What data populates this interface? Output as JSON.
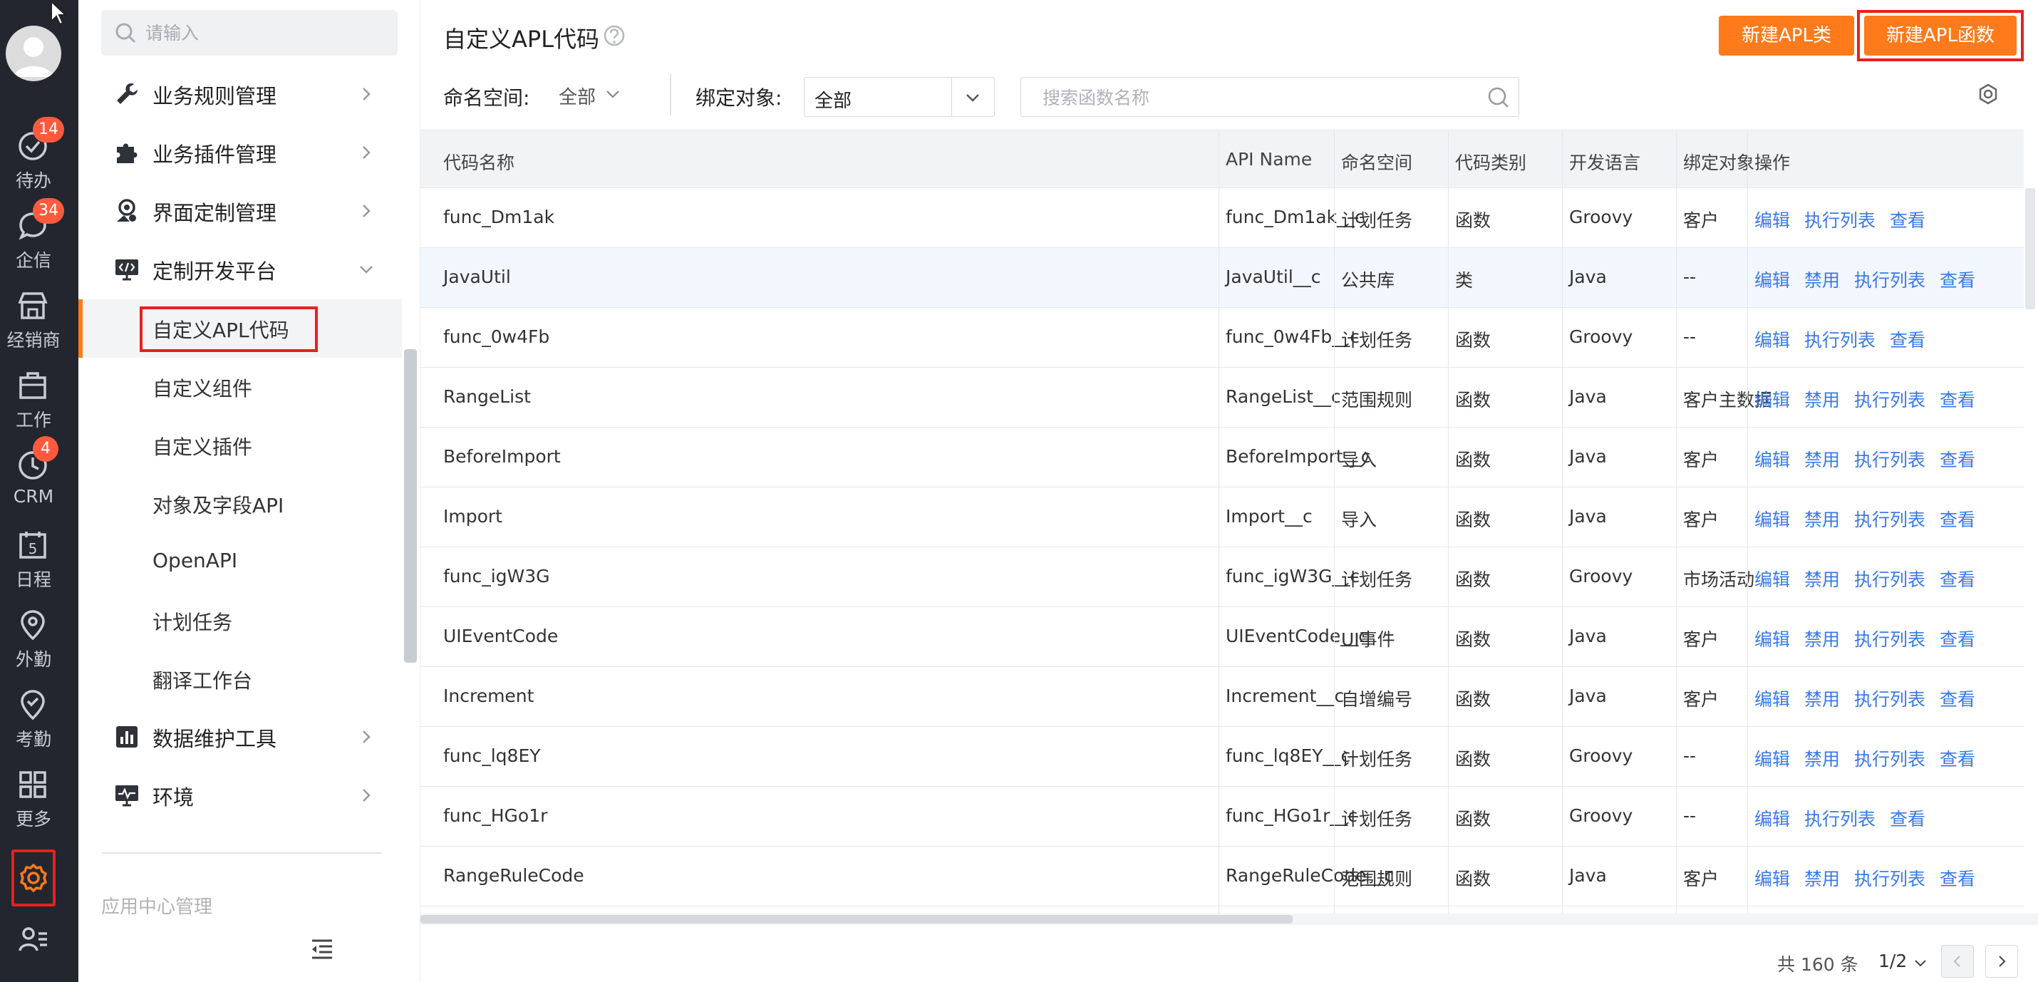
{
  "rail": {
    "items": [
      {
        "label": "待办",
        "icon": "check-circle-icon",
        "badge": "14"
      },
      {
        "label": "企信",
        "icon": "chat-bubble-icon",
        "badge": "34"
      },
      {
        "label": "经销商",
        "icon": "store-icon",
        "badge": ""
      },
      {
        "label": "工作",
        "icon": "briefcase-icon",
        "badge": ""
      },
      {
        "label": "CRM",
        "icon": "crm-clock-icon",
        "badge": "4"
      },
      {
        "label": "日程",
        "icon": "calendar-icon",
        "badge": ""
      },
      {
        "label": "外勤",
        "icon": "location-pin-icon",
        "badge": ""
      },
      {
        "label": "考勤",
        "icon": "attendance-check-icon",
        "badge": ""
      },
      {
        "label": "更多",
        "icon": "grid-icon",
        "badge": ""
      }
    ],
    "calendar_day": "5",
    "accent": "#ff7a1a"
  },
  "sidebar": {
    "search_placeholder": "请输入",
    "nav": [
      {
        "label": "业务规则管理",
        "icon": "wrench-icon"
      },
      {
        "label": "业务插件管理",
        "icon": "puzzle-icon"
      },
      {
        "label": "界面定制管理",
        "icon": "ui-customize-icon"
      },
      {
        "label": "定制开发平台",
        "icon": "code-monitor-icon"
      }
    ],
    "sub_items": [
      "自定义APL代码",
      "自定义组件",
      "自定义插件",
      "对象及字段API",
      "OpenAPI",
      "计划任务",
      "翻译工作台"
    ],
    "nav_bottom": [
      {
        "label": "数据维护工具",
        "icon": "bar-chart-icon"
      },
      {
        "label": "环境",
        "icon": "pulse-monitor-icon"
      }
    ],
    "app_center": "应用中心管理"
  },
  "main": {
    "title": "自定义APL代码",
    "btn_new_class": "新建APL类",
    "btn_new_function": "新建APL函数",
    "namespace_label": "命名空间:",
    "namespace_value": "全部",
    "bind_label": "绑定对象:",
    "bind_value": "全部",
    "search_placeholder": "搜索函数名称"
  },
  "table": {
    "headers": [
      "代码名称",
      "API Name",
      "命名空间",
      "代码类别",
      "开发语言",
      "绑定对象",
      "操作"
    ],
    "rows": [
      {
        "name": "func_Dm1ak",
        "api": "func_Dm1ak__c",
        "ns": "计划任务",
        "type": "函数",
        "lang": "Groovy",
        "bind": "客户",
        "ops": [
          "编辑",
          "执行列表",
          "查看"
        ]
      },
      {
        "name": "JavaUtil",
        "api": "JavaUtil__c",
        "ns": "公共库",
        "type": "类",
        "lang": "Java",
        "bind": "--",
        "ops": [
          "编辑",
          "禁用",
          "执行列表",
          "查看"
        ]
      },
      {
        "name": "func_0w4Fb",
        "api": "func_0w4Fb__c",
        "ns": "计划任务",
        "type": "函数",
        "lang": "Groovy",
        "bind": "--",
        "ops": [
          "编辑",
          "执行列表",
          "查看"
        ]
      },
      {
        "name": "RangeList",
        "api": "RangeList__c",
        "ns": "范围规则",
        "type": "函数",
        "lang": "Java",
        "bind": "客户主数据",
        "ops": [
          "编辑",
          "禁用",
          "执行列表",
          "查看"
        ]
      },
      {
        "name": "BeforeImport",
        "api": "BeforeImport__c",
        "ns": "导入",
        "type": "函数",
        "lang": "Java",
        "bind": "客户",
        "ops": [
          "编辑",
          "禁用",
          "执行列表",
          "查看"
        ]
      },
      {
        "name": "Import",
        "api": "Import__c",
        "ns": "导入",
        "type": "函数",
        "lang": "Java",
        "bind": "客户",
        "ops": [
          "编辑",
          "禁用",
          "执行列表",
          "查看"
        ]
      },
      {
        "name": "func_igW3G",
        "api": "func_igW3G__c",
        "ns": "计划任务",
        "type": "函数",
        "lang": "Groovy",
        "bind": "市场活动",
        "ops": [
          "编辑",
          "禁用",
          "执行列表",
          "查看"
        ]
      },
      {
        "name": "UIEventCode",
        "api": "UIEventCode__c",
        "ns": "UI事件",
        "type": "函数",
        "lang": "Java",
        "bind": "客户",
        "ops": [
          "编辑",
          "禁用",
          "执行列表",
          "查看"
        ]
      },
      {
        "name": "Increment",
        "api": "Increment__c",
        "ns": "自增编号",
        "type": "函数",
        "lang": "Java",
        "bind": "客户",
        "ops": [
          "编辑",
          "禁用",
          "执行列表",
          "查看"
        ]
      },
      {
        "name": "func_lq8EY",
        "api": "func_lq8EY__c",
        "ns": "计划任务",
        "type": "函数",
        "lang": "Groovy",
        "bind": "--",
        "ops": [
          "编辑",
          "禁用",
          "执行列表",
          "查看"
        ]
      },
      {
        "name": "func_HGo1r",
        "api": "func_HGo1r__c",
        "ns": "计划任务",
        "type": "函数",
        "lang": "Groovy",
        "bind": "--",
        "ops": [
          "编辑",
          "执行列表",
          "查看"
        ]
      },
      {
        "name": "RangeRuleCode",
        "api": "RangeRuleCode__c",
        "ns": "范围规则",
        "type": "函数",
        "lang": "Java",
        "bind": "客户",
        "ops": [
          "编辑",
          "禁用",
          "执行列表",
          "查看"
        ]
      }
    ]
  },
  "pagination": {
    "total": "共 160 条",
    "page": "1/2"
  }
}
